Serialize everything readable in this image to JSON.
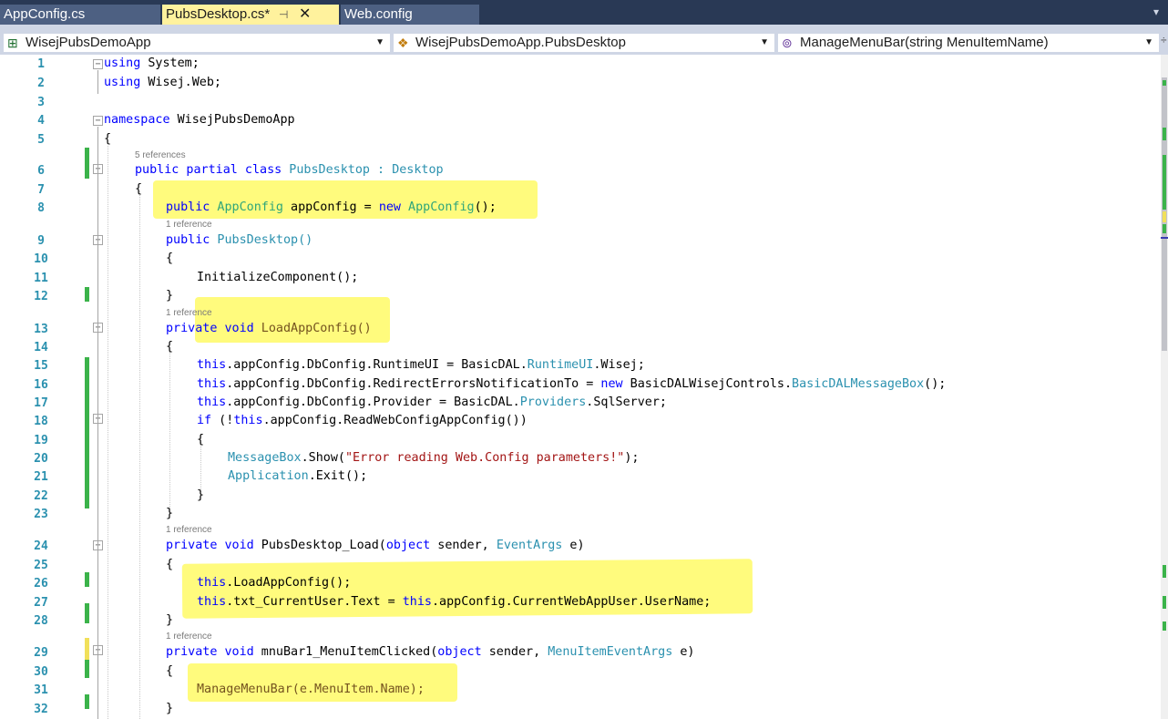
{
  "tabs": [
    {
      "label": "AppConfig.cs",
      "active": false
    },
    {
      "label": "PubsDesktop.cs*",
      "active": true
    },
    {
      "label": "Web.config",
      "active": false
    }
  ],
  "tab_icons": {
    "pin": "⊣",
    "close": "✕"
  },
  "nav": {
    "project": "WisejPubsDemoApp",
    "type": "WisejPubsDemoApp.PubsDesktop",
    "member": "ManageMenuBar(string MenuItemName)"
  },
  "codelens": {
    "class_refs": "5 references",
    "one_ref": "1 reference"
  },
  "lines": [
    "1",
    "2",
    "3",
    "4",
    "5",
    "6",
    "7",
    "8",
    "9",
    "10",
    "11",
    "12",
    "13",
    "14",
    "15",
    "16",
    "17",
    "18",
    "19",
    "20",
    "21",
    "22",
    "23",
    "24",
    "25",
    "26",
    "27",
    "28",
    "29",
    "30",
    "31",
    "32"
  ],
  "code": {
    "l1_using": "using",
    "l1_ns": " System;",
    "l2_using": "using",
    "l2_ns": " Wisej.Web;",
    "l4_namespace": "namespace",
    "l4_name": " WisejPubsDemoApp",
    "l5": "{",
    "l6_kw": "public partial class",
    "l6_name": " PubsDesktop : ",
    "l6_base": "Desktop",
    "l7": "{",
    "l8_kw": "public",
    "l8_type": " AppConfig",
    "l8_mid": " appConfig = ",
    "l8_new": "new",
    "l8_type2": " AppConfig",
    "l8_end": "();",
    "l9_kw": "public",
    "l9_name": " PubsDesktop()",
    "l10": "{",
    "l11": "InitializeComponent();",
    "l12": "}",
    "l13_kw": "private void",
    "l13_name": " LoadAppConfig()",
    "l14": "{",
    "l15_this": "this",
    "l15_a": ".appConfig.DbConfig.RuntimeUI = BasicDAL.",
    "l15_t": "RuntimeUI",
    "l15_b": ".Wisej;",
    "l16_this": "this",
    "l16_a": ".appConfig.DbConfig.RedirectErrorsNotificationTo = ",
    "l16_new": "new",
    "l16_b": " BasicDALWisejControls.",
    "l16_t": "BasicDALMessageBox",
    "l16_c": "();",
    "l17_this": "this",
    "l17_a": ".appConfig.DbConfig.Provider = BasicDAL.",
    "l17_t": "Providers",
    "l17_b": ".SqlServer;",
    "l18_if": "if",
    "l18_a": " (!",
    "l18_this": "this",
    "l18_b": ".appConfig.ReadWebConfigAppConfig())",
    "l19": "{",
    "l20_t": "MessageBox",
    "l20_a": ".Show(",
    "l20_s": "\"Error reading Web.Config parameters!\"",
    "l20_b": ");",
    "l21_t": "Application",
    "l21_a": ".Exit();",
    "l22": "}",
    "l23": "}",
    "l24_kw": "private void",
    "l24_a": " PubsDesktop_Load(",
    "l24_obj": "object",
    "l24_b": " sender, ",
    "l24_t": "EventArgs",
    "l24_c": " e)",
    "l25": "{",
    "l26_this": "this",
    "l26_a": ".LoadAppConfig();",
    "l27_this": "this",
    "l27_a": ".txt_CurrentUser.Text = ",
    "l27_this2": "this",
    "l27_b": ".appConfig.CurrentWebAppUser.UserName;",
    "l28": "}",
    "l29_kw": "private void",
    "l29_a": " mnuBar1_MenuItemClicked(",
    "l29_obj": "object",
    "l29_b": " sender, ",
    "l29_t": "MenuItemEventArgs",
    "l29_c": " e)",
    "l30": "{",
    "l31": "ManageMenuBar(e.MenuItem.Name);",
    "l32": "}"
  },
  "colors": {
    "tab_bar": "#293955",
    "active_tab": "#fff29d",
    "nav_bar": "#cfd6e5",
    "changed_saved": "#3bb34a",
    "changed_unsaved": "#f1e05a",
    "highlight": "#fffa66"
  }
}
